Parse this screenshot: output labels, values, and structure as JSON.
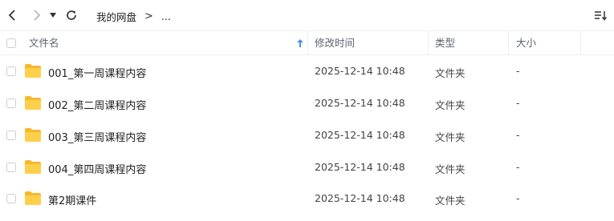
{
  "toolbar": {
    "breadcrumb_root": "我的网盘",
    "breadcrumb_sep": ">",
    "breadcrumb_more": "..."
  },
  "columns": {
    "name": "文件名",
    "mtime": "修改时间",
    "type": "类型",
    "size": "大小"
  },
  "rows": [
    {
      "name": "001_第一周课程内容",
      "mtime": "2025-12-14 10:48",
      "type": "文件夹",
      "size": "-"
    },
    {
      "name": "002_第二周课程内容",
      "mtime": "2025-12-14 10:48",
      "type": "文件夹",
      "size": "-"
    },
    {
      "name": "003_第三周课程内容",
      "mtime": "2025-12-14 10:48",
      "type": "文件夹",
      "size": "-"
    },
    {
      "name": "004_第四周课程内容",
      "mtime": "2025-12-14 10:48",
      "type": "文件夹",
      "size": "-"
    },
    {
      "name": "第2期课件",
      "mtime": "2025-12-14 10:48",
      "type": "文件夹",
      "size": "-"
    }
  ],
  "colors": {
    "folder": "#FFC83D",
    "sort_arrow": "#4A90E2"
  },
  "icons": [
    "back-icon",
    "forward-icon",
    "history-dropdown-icon",
    "refresh-icon",
    "sort-menu-icon",
    "folder-icon",
    "sort-ascending-icon"
  ]
}
